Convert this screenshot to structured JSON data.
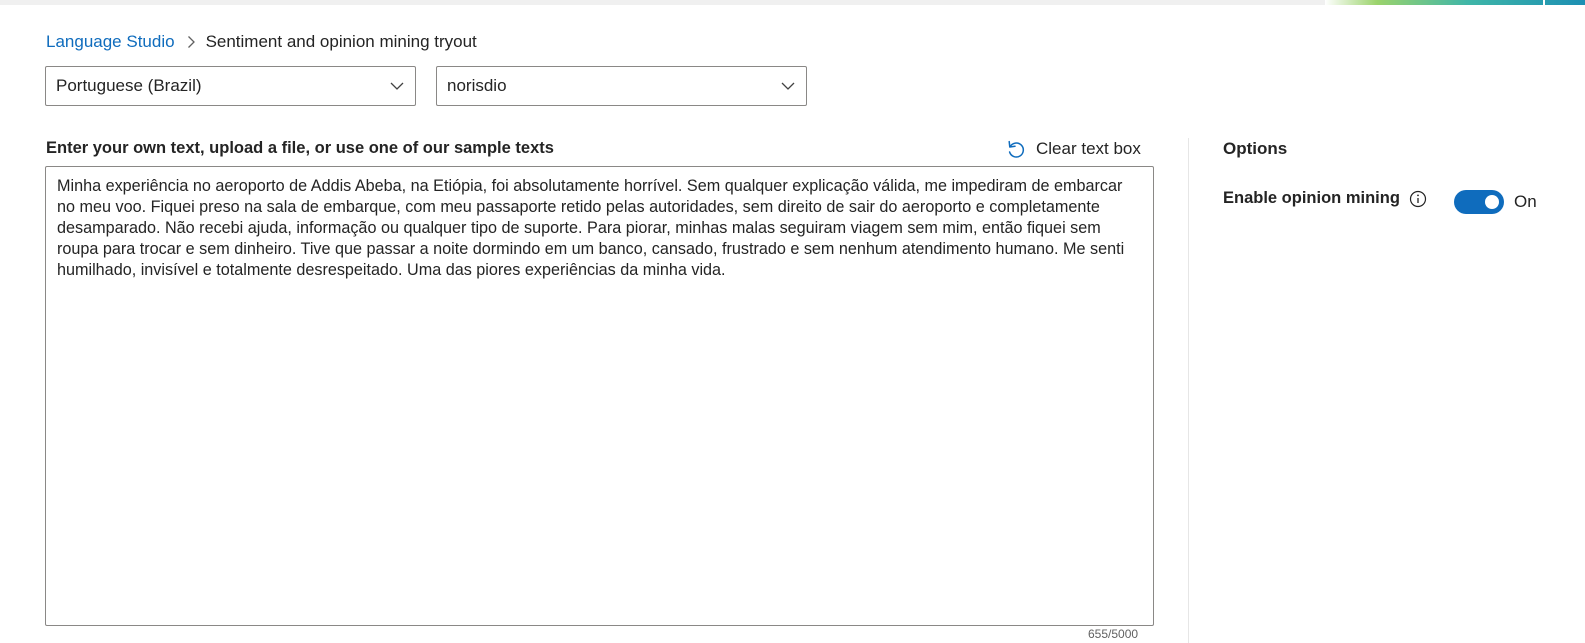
{
  "breadcrumb": {
    "root": "Language Studio",
    "current": "Sentiment and opinion mining tryout"
  },
  "language_select": {
    "value": "Portuguese (Brazil)"
  },
  "resource_select": {
    "value": "norisdio"
  },
  "input": {
    "header": "Enter your own text, upload a file, or use one of our sample texts",
    "clear_label": "Clear text box",
    "text": "Minha experiência no aeroporto de Addis Abeba, na Etiópia, foi absolutamente horrível. Sem qualquer explicação válida, me impediram de embarcar no meu voo. Fiquei preso na sala de embarque, com meu passaporte retido pelas autoridades, sem direito de sair do aeroporto e completamente desamparado. Não recebi ajuda, informação ou qualquer tipo de suporte. Para piorar, minhas malas seguiram viagem sem mim, então fiquei sem roupa para trocar e sem dinheiro. Tive que passar a noite dormindo em um banco, cansado, frustrado e sem nenhum atendimento humano. Me senti humilhado, invisível e totalmente desrespeitado. Uma das piores experiências da minha vida.",
    "char_count": "655/5000"
  },
  "options": {
    "title": "Options",
    "opinion_mining_label": "Enable opinion mining",
    "opinion_mining_state": "On",
    "opinion_mining_enabled": true
  },
  "colors": {
    "accent": "#0f6cbd",
    "border": "#8a8886"
  },
  "icons": {
    "breadcrumb_separator": "chevron-right-icon",
    "select_caret": "chevron-down-icon",
    "clear": "undo-icon",
    "info": "info-icon"
  }
}
